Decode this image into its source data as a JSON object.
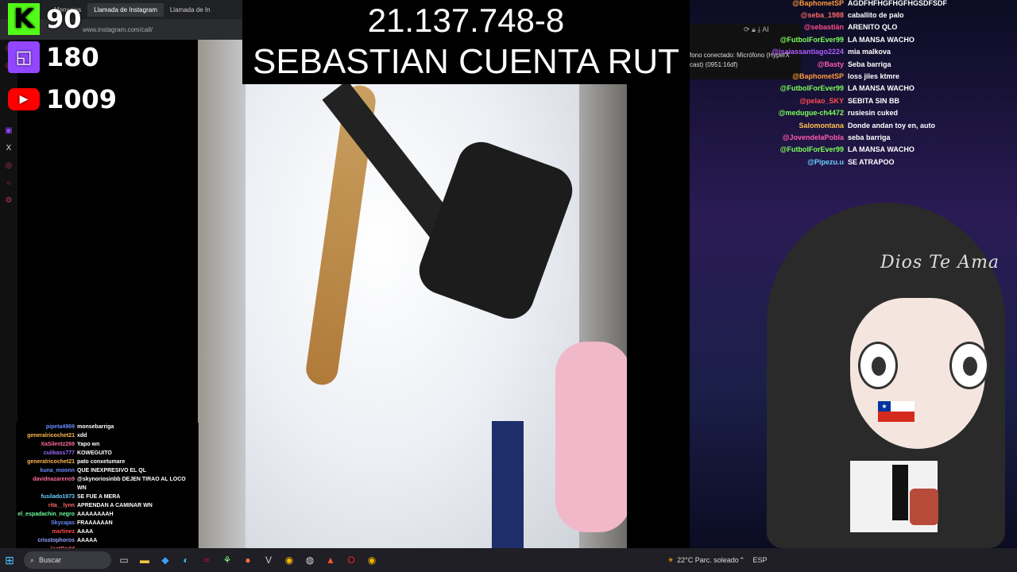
{
  "browser": {
    "tabs": [
      "Mensajes",
      "Llamada de Instagram",
      "Llamada de In"
    ],
    "url": "www.instagram.com/call/"
  },
  "counters": {
    "kick": {
      "icon": "kick-logo-icon",
      "glyph": "K",
      "value": "90"
    },
    "twitch": {
      "icon": "twitch-logo-icon",
      "value": "180"
    },
    "youtube": {
      "icon": "youtube-logo-icon",
      "value": "1009"
    }
  },
  "caption": {
    "line1": "21.137.748-8",
    "line2": "SEBASTIAN CUENTA RUT"
  },
  "mic_panel": {
    "text": "fono conectado: Micrófono (HyperX cast) (0951:16df)",
    "ai_label": "AI"
  },
  "right_chat": [
    {
      "user": "@BaphometSP",
      "msg": "AGDFHFHGFHGFHGSDFSDF",
      "color": "#ff9a3c"
    },
    {
      "user": "@seba_1988",
      "msg": "caballito de palo",
      "color": "#ff6a6a"
    },
    {
      "user": "@sebastián",
      "msg": "ARENITO QLO",
      "color": "#ff4d8a"
    },
    {
      "user": "@FutbolForEver99",
      "msg": "LA MANSA WACHO",
      "color": "#7cff5a"
    },
    {
      "user": "@isaiassantiago2224",
      "msg": "mia malkova",
      "color": "#b05cff"
    },
    {
      "user": "@Basty",
      "msg": "Seba barriga",
      "color": "#ff5ab0"
    },
    {
      "user": "@BaphometSP",
      "msg": "loss jiles ktmre",
      "color": "#ff9a3c"
    },
    {
      "user": "@FutbolForEver99",
      "msg": "LA MANSA WACHO",
      "color": "#7cff5a"
    },
    {
      "user": "@pelao_SKY",
      "msg": "SEBITA SIN BB",
      "color": "#ff4d4d"
    },
    {
      "user": "@medugue-ch4472",
      "msg": "rusiesin cuked",
      "color": "#7cff5a"
    },
    {
      "user": "Salomontana",
      "msg": "Donde andan toy en, auto",
      "color": "#ffc04d"
    },
    {
      "user": "@JovendelaPobla",
      "msg": "seba barriga",
      "color": "#ff5ab0"
    },
    {
      "user": "@FutbolForEver99",
      "msg": "LA MANSA WACHO",
      "color": "#7cff5a"
    },
    {
      "user": "@Pipezu.u",
      "msg": "SE ATRAPOO",
      "color": "#6ad0ff"
    }
  ],
  "avatar_text": "Dios Te Ama",
  "left_chat": [
    {
      "user": "pipeta4969",
      "msg": "monsebarriga",
      "color": "#6a8cff"
    },
    {
      "user": "generalricochet21",
      "msg": "xdd",
      "color": "#ffb84d"
    },
    {
      "user": "XaSilentz269",
      "msg": "Yapo wn",
      "color": "#ff6aa0"
    },
    {
      "user": "culikass777",
      "msg": "KOWEGUITO",
      "color": "#9a6aff"
    },
    {
      "user": "generalricochet21",
      "msg": "pato conxetumare",
      "color": "#ffb84d"
    },
    {
      "user": "kuna_moonn",
      "msg": "QUE INEXPRESIVO EL QL",
      "color": "#6a8cff"
    },
    {
      "user": "davidnazareno9",
      "msg": "@skynoriosinbb DEJEN TIRAO AL LOCO WN",
      "color": "#ff6aa0"
    },
    {
      "user": "fusilado1973",
      "msg": "SE FUE A MERA",
      "color": "#6ad0ff"
    },
    {
      "user": "rita__lynn",
      "msg": "APRENDAN A CAMINAR WN",
      "color": "#ff6a6a"
    },
    {
      "user": "el_espadachin_negro",
      "msg": "AAAAAAAAH",
      "color": "#6aff9a"
    },
    {
      "user": "Skycajas",
      "msg": "FRAAAAAAN",
      "color": "#6a8cff"
    },
    {
      "user": "martinez",
      "msg": "AAAA",
      "color": "#ff4d4d"
    },
    {
      "user": "crisstophoros",
      "msg": "AAAAA",
      "color": "#9aa0ff"
    },
    {
      "user": "lastRodd",
      "msg": "",
      "color": "#ff6a6a"
    }
  ],
  "taskbar": {
    "search_placeholder": "Buscar",
    "weather": "22°C  Parc. soleado",
    "language": "ESP"
  }
}
